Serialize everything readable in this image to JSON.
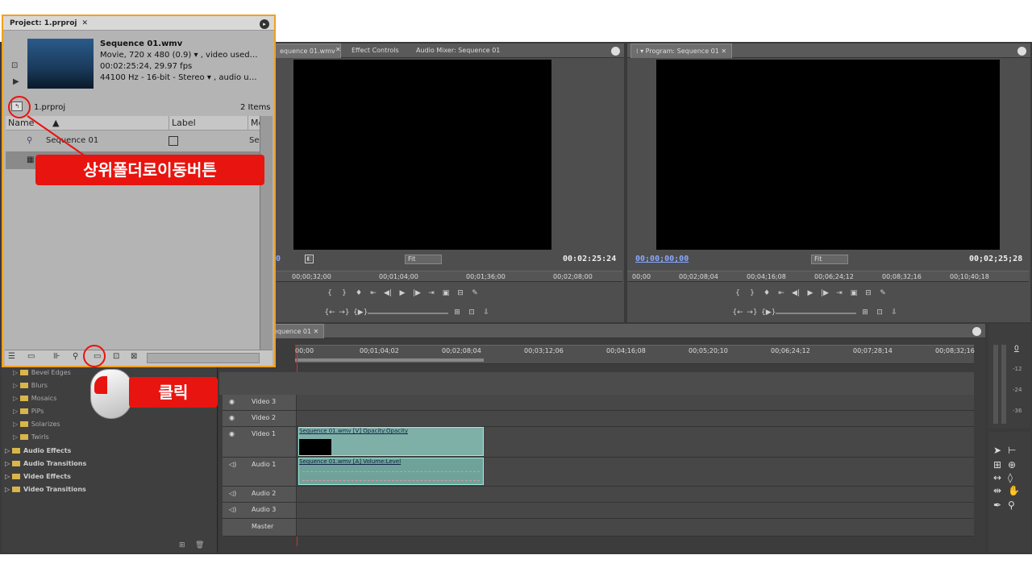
{
  "source_monitor": {
    "tabs": [
      "equence 01.wmv",
      "Effect Controls",
      "Audio Mixer: Sequence 01"
    ],
    "timecode_left": "0",
    "fit_label": "Fit",
    "timecode_right": "00:02:25:24",
    "ruler": [
      "00;00;32;00",
      "00;01;04;00",
      "00;01;36;00",
      "00;02;08;00"
    ]
  },
  "program_monitor": {
    "tab": "Program: Sequence 01",
    "timecode_left": "00;00;00;00",
    "fit_label": "Fit",
    "timecode_right": "00;02;25;28",
    "ruler": [
      "00;00",
      "00;02;08;04",
      "00;04;16;08",
      "00;06;24;12",
      "00;08;32;16",
      "00;10;40;18"
    ]
  },
  "timeline": {
    "tab": "equence 01",
    "ruler": [
      "00;00",
      "00;01;04;02",
      "00;02;08;04",
      "00;03;12;06",
      "00;04;16;08",
      "00;05;20;10",
      "00;06;24;12",
      "00;07;28;14",
      "00;08;32;16"
    ],
    "tracks": [
      {
        "name": "Video 3"
      },
      {
        "name": "Video 2"
      },
      {
        "name": "Video 1",
        "clip": "Sequence 01.wmv [V] Opacity:Opacity"
      },
      {
        "name": "Audio 1",
        "clip": "Sequence 01.wmv [A] Volume:Level"
      },
      {
        "name": "Audio 2"
      },
      {
        "name": "Audio 3"
      },
      {
        "name": "Master"
      }
    ]
  },
  "effects": {
    "sub_items": [
      "Bevel Edges",
      "Blurs",
      "Mosaics",
      "PiPs",
      "Solarizes",
      "Twirls"
    ],
    "items": [
      "Audio Effects",
      "Audio Transitions",
      "Video Effects",
      "Video Transitions"
    ]
  },
  "project": {
    "title": "Project: 1.prproj",
    "clip_name": "Sequence 01.wmv",
    "info1": "Movie, 720 x 480 (0.9)",
    "info1b": ", video used…",
    "info2": "00:02:25:24, 29.97 fps",
    "info3": "44100 Hz - 16-bit - Stereo",
    "info3b": ", audio u…",
    "bin_name": "1.prproj",
    "item_count": "2 Items",
    "col_name": "Name",
    "col_label": "Label",
    "col_media": "Me",
    "row1_name": "Sequence 01",
    "row1_media": "Sec"
  },
  "audio_meter": {
    "scale": [
      "0",
      "-12",
      "-24",
      "-36"
    ]
  },
  "annotations": {
    "up_folder": "상위폴더로이동버튼",
    "click": "클릭"
  },
  "colors": {
    "accent_orange": "#f0a020",
    "callout_red": "#e8140f"
  }
}
